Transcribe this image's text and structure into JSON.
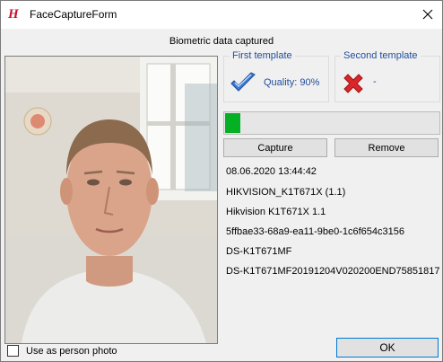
{
  "window": {
    "title": "FaceCaptureForm",
    "icon": "app-logo-h"
  },
  "status": "Biometric data captured",
  "photo": {
    "use_as_person_photo_label": "Use as person photo",
    "use_as_person_photo_checked": false
  },
  "first_template": {
    "title": "First template",
    "quality": "Quality: 90%",
    "state_icon": "checkmark-icon"
  },
  "second_template": {
    "title": "Second template",
    "quality": "-",
    "state_icon": "red-x-icon"
  },
  "progress": {
    "value": 0.07
  },
  "buttons": {
    "capture": "Capture",
    "remove": "Remove",
    "ok": "OK"
  },
  "info": {
    "timestamp": "08.06.2020 13:44:42",
    "device_model": "HIKVISION_K1T671X (1.1)",
    "vendor": "Hikvision K1T671X 1.1",
    "guid": "5ffbae33-68a9-ea11-9be0-1c6f654c3156",
    "device_type": "DS-K1T671MF",
    "serial": "DS-K1T671MF20191204V020200END75851817"
  },
  "colors": {
    "accent": "#1f4e9a",
    "progress": "#06b025",
    "logo": "#c8102e",
    "reject": "#d9262a"
  }
}
